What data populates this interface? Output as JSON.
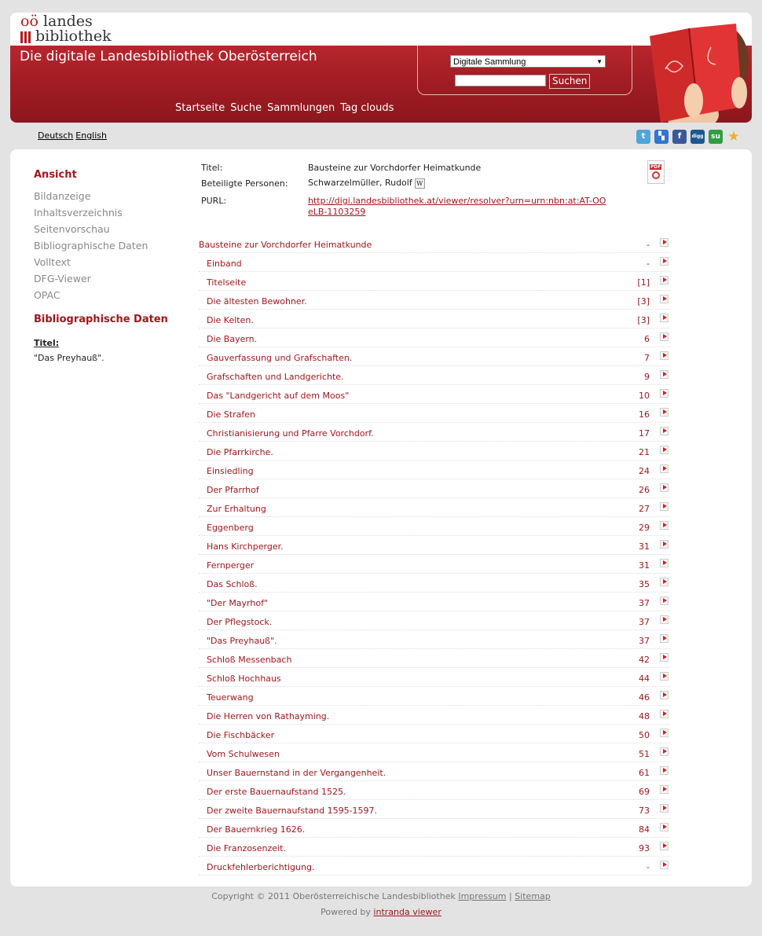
{
  "header": {
    "logo": {
      "line1_prefix": "oö",
      "line1": "landes",
      "line2": "bibliothek"
    },
    "title": "Die digitale Landesbibliothek Oberösterreich",
    "search": {
      "select_value": "Digitale Sammlung",
      "button": "Suchen",
      "input_value": ""
    },
    "nav": [
      "Startseite",
      "Suche",
      "Sammlungen",
      "Tag clouds"
    ]
  },
  "lang": [
    "Deutsch",
    "English"
  ],
  "social": [
    {
      "name": "twitter",
      "glyph": "t",
      "color": "#4fa6d9"
    },
    {
      "name": "delicious",
      "glyph": "▚",
      "color": "#3274d0"
    },
    {
      "name": "facebook",
      "glyph": "f",
      "color": "#3b5998"
    },
    {
      "name": "digg",
      "glyph": "digg",
      "color": "#1b5891"
    },
    {
      "name": "stumbleupon",
      "glyph": "su",
      "color": "#2f9e43"
    },
    {
      "name": "favorite",
      "glyph": "★",
      "color": "#f2b01e"
    }
  ],
  "sidebar": {
    "ansicht_heading": "Ansicht",
    "items": [
      "Bildanzeige",
      "Inhaltsverzeichnis",
      "Seitenvorschau",
      "Bibliographische Daten",
      "Volltext",
      "DFG-Viewer",
      "OPAC"
    ],
    "bib_heading": "Bibliographische Daten",
    "title_label": "Titel:",
    "title_value": "\"Das Preyhauß\"."
  },
  "meta": {
    "title_label": "Titel:",
    "title_value": "Bausteine zur Vorchdorfer Heimatkunde",
    "persons_label": "Beteiligte Personen:",
    "persons_value": "Schwarzelmüller, Rudolf",
    "wiki_glyph": "W",
    "purl_label": "PURL:",
    "purl_value": "http://digi.landesbibliothek.at/viewer/resolver?urn=urn:nbn:at:AT-OOeLB-1103259",
    "pdf_tag": "PDF"
  },
  "toc": [
    {
      "title": "Bausteine zur Vorchdorfer Heimatkunde",
      "page": "-",
      "level": 0
    },
    {
      "title": "Einband",
      "page": "-",
      "level": 1
    },
    {
      "title": "Titelseite",
      "page": "[1]",
      "level": 1
    },
    {
      "title": "Die ältesten Bewohner.",
      "page": "[3]",
      "level": 1
    },
    {
      "title": "Die Kelten.",
      "page": "[3]",
      "level": 1
    },
    {
      "title": "Die Bayern.",
      "page": "6",
      "level": 1
    },
    {
      "title": "Gauverfassung und Grafschaften.",
      "page": "7",
      "level": 1
    },
    {
      "title": "Grafschaften und Landgerichte.",
      "page": "9",
      "level": 1
    },
    {
      "title": "Das \"Landgericht auf dem Moos\"",
      "page": "10",
      "level": 1
    },
    {
      "title": "Die Strafen",
      "page": "16",
      "level": 1
    },
    {
      "title": "Christianisierung und Pfarre Vorchdorf.",
      "page": "17",
      "level": 1
    },
    {
      "title": "Die Pfarrkirche.",
      "page": "21",
      "level": 1
    },
    {
      "title": "Einsiedling",
      "page": "24",
      "level": 1
    },
    {
      "title": "Der Pfarrhof",
      "page": "26",
      "level": 1
    },
    {
      "title": "Zur Erhaltung",
      "page": "27",
      "level": 1
    },
    {
      "title": "Eggenberg",
      "page": "29",
      "level": 1
    },
    {
      "title": "Hans Kirchperger.",
      "page": "31",
      "level": 1
    },
    {
      "title": "Fernperger",
      "page": "31",
      "level": 1
    },
    {
      "title": "Das Schloß.",
      "page": "35",
      "level": 1
    },
    {
      "title": "\"Der Mayrhof\"",
      "page": "37",
      "level": 1
    },
    {
      "title": "Der Pflegstock.",
      "page": "37",
      "level": 1
    },
    {
      "title": "\"Das Preyhauß\".",
      "page": "37",
      "level": 1
    },
    {
      "title": "Schloß Messenbach",
      "page": "42",
      "level": 1
    },
    {
      "title": "Schloß Hochhaus",
      "page": "44",
      "level": 1
    },
    {
      "title": "Teuerwang",
      "page": "46",
      "level": 1
    },
    {
      "title": "Die Herren von Rathayming.",
      "page": "48",
      "level": 1
    },
    {
      "title": "Die Fischbäcker",
      "page": "50",
      "level": 1
    },
    {
      "title": "Vom Schulwesen",
      "page": "51",
      "level": 1
    },
    {
      "title": "Unser Bauernstand in der Vergangenheit.",
      "page": "61",
      "level": 1
    },
    {
      "title": "Der erste Bauernaufstand 1525.",
      "page": "69",
      "level": 1
    },
    {
      "title": "Der zweite Bauernaufstand 1595-1597.",
      "page": "73",
      "level": 1
    },
    {
      "title": "Der Bauernkrieg 1626.",
      "page": "84",
      "level": 1
    },
    {
      "title": "Die Franzosenzeit.",
      "page": "93",
      "level": 1
    },
    {
      "title": "Druckfehlerberichtigung.",
      "page": "-",
      "level": 1
    }
  ],
  "footer": {
    "copyright": "Copyright © 2011 Oberösterreichische Landesbibliothek",
    "impressum": "Impressum",
    "separator": "|",
    "sitemap": "Sitemap",
    "powered_by": "Powered by",
    "powered_link": "intranda viewer"
  }
}
